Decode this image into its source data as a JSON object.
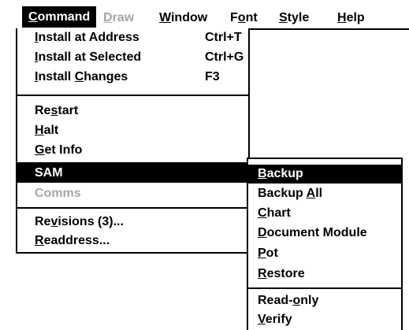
{
  "menubar": {
    "items": [
      {
        "pre": "",
        "u": "C",
        "post": "ommand",
        "state": "active"
      },
      {
        "pre": "",
        "u": "D",
        "post": "raw",
        "state": "disabled"
      },
      {
        "pre": "",
        "u": "W",
        "post": "indow",
        "state": "normal"
      },
      {
        "pre": "F",
        "u": "o",
        "post": "nt",
        "state": "normal"
      },
      {
        "pre": "",
        "u": "S",
        "post": "tyle",
        "state": "normal"
      },
      {
        "pre": "",
        "u": "H",
        "post": "elp",
        "state": "normal"
      }
    ]
  },
  "command_menu": {
    "items": [
      {
        "pre": "",
        "u": "I",
        "post": "nstall at Address",
        "shortcut": "Ctrl+T"
      },
      {
        "pre": "",
        "u": "I",
        "post": "nstall at Selected",
        "shortcut": "Ctrl+G"
      },
      {
        "pre": "",
        "u": "I",
        "post": "nstall ",
        "u2": "C",
        "post2": "hanges",
        "shortcut": "F3"
      },
      {
        "pre": "Re",
        "u": "s",
        "post": "tart"
      },
      {
        "pre": "",
        "u": "H",
        "post": "alt"
      },
      {
        "pre": "",
        "u": "G",
        "post": "et Info"
      },
      {
        "pre": "",
        "u": "",
        "post": "SAM",
        "state": "highlight"
      },
      {
        "pre": "",
        "u": "",
        "post": "Comms",
        "state": "disabled"
      },
      {
        "pre": "Re",
        "u": "v",
        "post": "isions (3)..."
      },
      {
        "pre": "",
        "u": "R",
        "post": "eaddress..."
      }
    ]
  },
  "sam_submenu": {
    "items": [
      {
        "pre": "",
        "u": "B",
        "post": "ackup",
        "state": "highlight"
      },
      {
        "pre": "Backup ",
        "u": "A",
        "post": "ll"
      },
      {
        "pre": "",
        "u": "C",
        "post": "hart"
      },
      {
        "pre": "",
        "u": "D",
        "post": "ocument Module"
      },
      {
        "pre": "",
        "u": "P",
        "post": "ot"
      },
      {
        "pre": "",
        "u": "R",
        "post": "estore"
      },
      {
        "pre": "Read-",
        "u": "o",
        "post": "nly"
      },
      {
        "pre": "",
        "u": "V",
        "post": "erify"
      }
    ]
  }
}
